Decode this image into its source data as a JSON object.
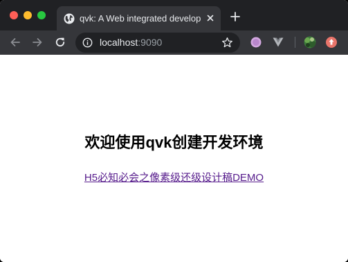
{
  "browser": {
    "tab": {
      "title": "qvk: A Web integrated develop",
      "favicon": "globe-icon"
    },
    "address_bar": {
      "host": "localhost",
      "port": ":9090"
    },
    "icons": {
      "back": "arrow-left-icon",
      "forward": "arrow-right-icon",
      "reload": "reload-icon",
      "info": "info-icon",
      "bookmark": "star-icon",
      "new_tab": "plus-icon",
      "tab_close": "close-icon",
      "extensions": [
        "purple-circle-extension-icon",
        "vue-devtools-icon",
        "avatar-icon",
        "red-upload-extension-icon"
      ]
    },
    "colors": {
      "tabstrip": "#202124",
      "toolbar": "#35363a",
      "visited_link": "#551a8b"
    }
  },
  "page": {
    "heading": "欢迎使用qvk创建开发环境",
    "link_text": "H5必知必会之像素级还级设计稿DEMO"
  }
}
